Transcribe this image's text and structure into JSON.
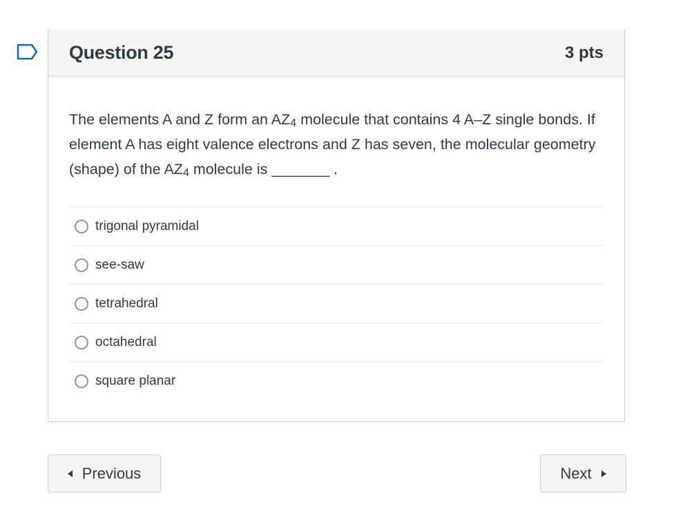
{
  "question": {
    "title": "Question 25",
    "points": "3 pts",
    "text_part1": "The elements A and Z form an AZ",
    "sub1": "4",
    "text_part2": " molecule that contains 4 A–Z single bonds. If element A has eight valence electrons and Z has seven, the molecular geometry (shape) of the AZ",
    "sub2": "4",
    "text_part3": " molecule is _______ ."
  },
  "answers": [
    {
      "label": "trigonal pyramidal"
    },
    {
      "label": "see-saw"
    },
    {
      "label": "tetrahedral"
    },
    {
      "label": "octahedral"
    },
    {
      "label": "square planar"
    }
  ],
  "navigation": {
    "previous_label": "Previous",
    "next_label": "Next"
  },
  "icons": {
    "flag": "bookmark-flag-icon",
    "previous": "caret-left-icon",
    "next": "caret-right-icon"
  },
  "colors": {
    "text": "#2d3b45",
    "flag_accent": "#0770a3",
    "header_bg": "#f5f5f5",
    "border": "#c7cdd1"
  }
}
